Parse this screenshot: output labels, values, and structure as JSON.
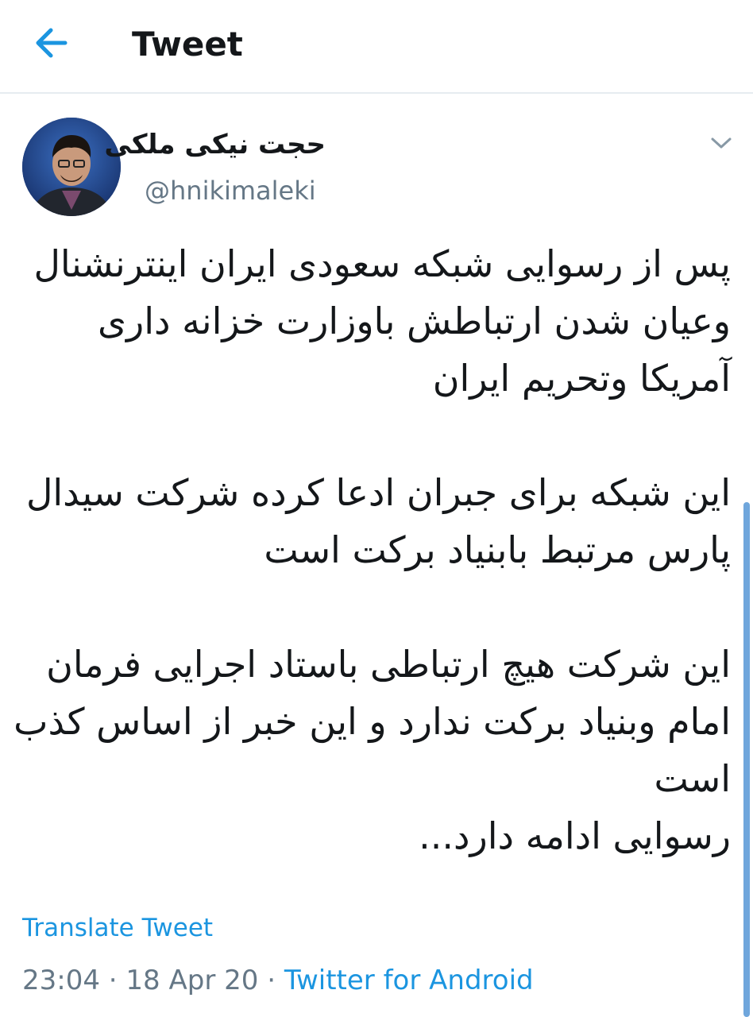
{
  "header": {
    "title": "Tweet",
    "back_icon": "arrow-left-icon"
  },
  "colors": {
    "accent": "#1b95e0",
    "text": "#14171a",
    "muted": "#657786",
    "divider": "#e6ecf0"
  },
  "author": {
    "display_name": "حجت نیکی ملکی",
    "handle": "@hnikimaleki"
  },
  "tweet": {
    "lines": [
      "پس از رسوایی شبکه سعودی ایران اینترنشنال",
      "وعیان شدن ارتباطش باوزارت خزانه داری ",
      "آمریکا وتحریم ایران",
      "",
      "این شبکه برای جبران ادعا کرده شرکت سیدال",
      "پارس مرتبط بابنیاد برکت است",
      "",
      "این شرکت هیچ ارتباطی باستاد اجرایی فرمان",
      "امام وبنیاد برکت ندارد و این خبر از اساس کذب",
      "است",
      "رسوایی ادامه دارد..."
    ]
  },
  "actions": {
    "translate_label": "Translate Tweet"
  },
  "meta": {
    "time": "23:04",
    "separator": " · ",
    "date": "18 Apr 20",
    "source": "Twitter for Android"
  }
}
